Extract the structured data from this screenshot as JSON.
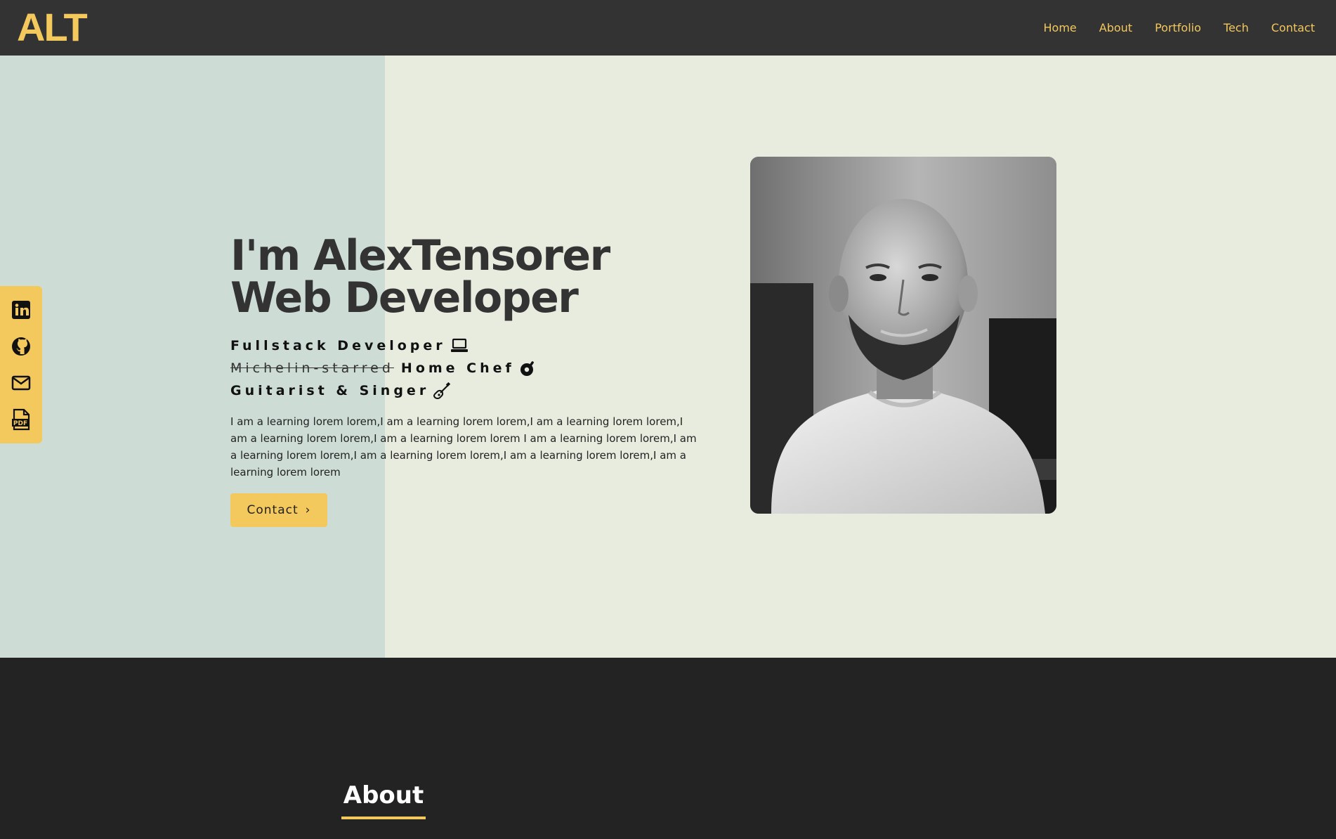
{
  "header": {
    "logo": "ALT",
    "nav": [
      "Home",
      "About",
      "Portfolio",
      "Tech",
      "Contact"
    ]
  },
  "social": [
    {
      "icon": "linkedin-icon"
    },
    {
      "icon": "github-icon"
    },
    {
      "icon": "mail-icon"
    },
    {
      "icon": "pdf-icon"
    }
  ],
  "hero": {
    "headline_line1": "I'm AlexTensorer",
    "headline_line2": "Web Developer",
    "role1": "Fullstack Developer",
    "role2_strike": "Michelin-starred",
    "role2": "Home Chef",
    "role3": "Guitarist & Singer",
    "bio": "I am a learning lorem lorem,I am a learning lorem lorem,I am a learning lorem lorem,I am a learning lorem lorem,I am a learning lorem lorem I am a learning lorem lorem,I am a learning lorem lorem,I am a learning lorem lorem,I am a learning lorem lorem,I am a learning lorem lorem",
    "contact_button": "Contact",
    "contact_chevron": "›"
  },
  "about": {
    "title": "About"
  },
  "colors": {
    "accent": "#f3c85d",
    "header_bg": "#333333",
    "hero_bg": "#e8ecdf",
    "hero_panel": "#cdddd6",
    "dark_bg": "#232323"
  }
}
